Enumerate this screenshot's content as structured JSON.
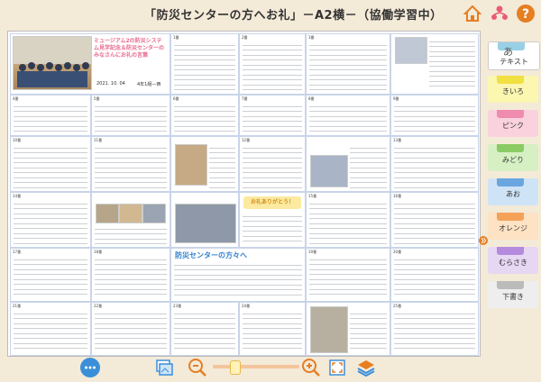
{
  "header": {
    "title": "「防災センターの方へお礼」－A2横－（協働学習中）"
  },
  "icons": {
    "home": "home-icon",
    "people": "group-icon",
    "help": "help-icon"
  },
  "board": {
    "featured": {
      "title": "ミュージアム2の防災システム見学記念＆防災センターのみなさんにお礼の言葉",
      "date": "2021. 10. 04",
      "class": "4年1組—西"
    },
    "notes": [
      {
        "num": "1番",
        "text": "防災センターの方々へ"
      },
      {
        "num": "2番",
        "text": "防災センターの方々へ"
      },
      {
        "num": "3番",
        "text": "防災センターの方々へ"
      },
      {
        "num": "4番",
        "text": "防災センターの方へ"
      },
      {
        "num": "5番",
        "text": "防災センターの方々へ"
      },
      {
        "num": "6番",
        "text": "防災センターの方々へ"
      },
      {
        "num": "7番",
        "text": "防災センターの方々へ"
      },
      {
        "num": "8番",
        "text": "防災センターの方々へ"
      },
      {
        "num": "9番",
        "text": "防災センターの方々へ"
      },
      {
        "num": "10番",
        "text": "防災センターの方々へ"
      },
      {
        "num": "11番",
        "text": "防災センターの方々へ"
      },
      {
        "num": "12番",
        "text": "防災センターの方々へ"
      },
      {
        "num": "13番",
        "text": "防災センターの方々へ"
      },
      {
        "num": "14番",
        "text": "防災センターの方々へ"
      },
      {
        "num": "15番",
        "text": "防災センターの方々へ"
      },
      {
        "num": "16番",
        "text": "防災センターの方々へ"
      },
      {
        "num": "17番",
        "text": "防災センターの方々へ"
      },
      {
        "num": "18番",
        "text": "防災センターの方々へ"
      },
      {
        "num": "19番",
        "text": "防災センターの方々へ"
      },
      {
        "num": "20番",
        "text": "防災センターの方々へ"
      },
      {
        "num": "21番",
        "text": "防災センターの方々へ"
      },
      {
        "num": "22番",
        "text": "防災センターの方々へ"
      },
      {
        "num": "23番",
        "text": "防災センターの方々へ"
      },
      {
        "num": "24番",
        "text": "防災センターの方々へ"
      },
      {
        "num": "25番",
        "text": "防災センターの方々へ"
      },
      {
        "num": "26番",
        "text": "防災センターの方々へ"
      },
      {
        "num": "27番",
        "text": "防災センターの方々へ"
      },
      {
        "num": "28番",
        "text": "防災センターの方々へ"
      },
      {
        "num": "29番",
        "text": "防災センターの方々へ"
      }
    ],
    "banners": [
      "お礼ありがとう！",
      "防災センターの方々へ"
    ]
  },
  "palette": {
    "items": [
      {
        "label": "テキスト",
        "color": "#ffffff",
        "tab": "#9ad0e6"
      },
      {
        "label": "きいろ",
        "color": "#fbf6b0",
        "tab": "#f0e040"
      },
      {
        "label": "ピンク",
        "color": "#f9d2de",
        "tab": "#f08bb0"
      },
      {
        "label": "みどり",
        "color": "#d6f0c4",
        "tab": "#8acb63"
      },
      {
        "label": "あお",
        "color": "#cfe3f7",
        "tab": "#6aa6e0"
      },
      {
        "label": "オレンジ",
        "color": "#fde2c4",
        "tab": "#f5a259"
      },
      {
        "label": "むらさき",
        "color": "#e6d7f3",
        "tab": "#b58bdd"
      },
      {
        "label": "下書き",
        "color": "#eeeeee",
        "tab": "#bbbbbb"
      }
    ],
    "text_glyph": "あ"
  },
  "toolbar": {
    "zoom_level": 0.25
  },
  "colors": {
    "accent": "#e67e22",
    "background": "#f4ead8",
    "grid_line": "#c9d4e8"
  }
}
